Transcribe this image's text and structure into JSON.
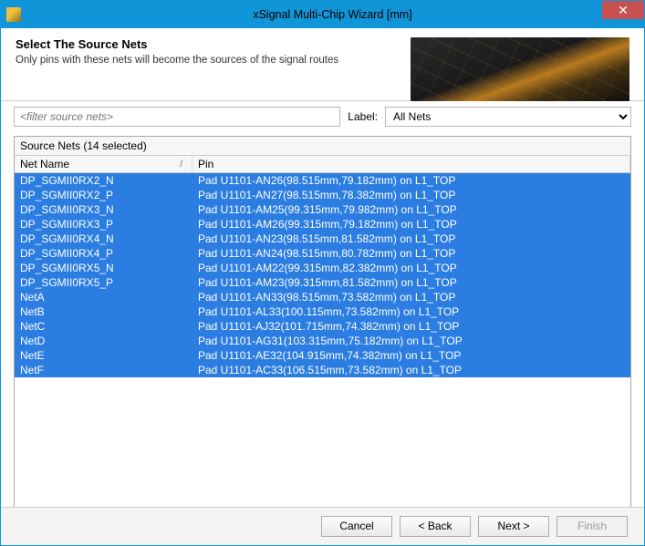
{
  "window": {
    "title": "xSignal Multi-Chip Wizard [mm]"
  },
  "header": {
    "heading": "Select The Source Nets",
    "sub": "Only pins with these nets will become the sources of the signal routes"
  },
  "filter": {
    "placeholder": "<filter source nets>"
  },
  "label": {
    "caption": "Label:",
    "selected": "All Nets",
    "options": [
      "All Nets"
    ]
  },
  "grid": {
    "caption": "Source Nets (14 selected)",
    "columns": {
      "net": "Net Name",
      "pin": "Pin"
    },
    "rows": [
      {
        "net": "DP_SGMII0RX2_N",
        "pin": "Pad U1101-AN26(98.515mm,79.182mm) on L1_TOP"
      },
      {
        "net": "DP_SGMII0RX2_P",
        "pin": "Pad U1101-AN27(98.515mm,78.382mm) on L1_TOP"
      },
      {
        "net": "DP_SGMII0RX3_N",
        "pin": "Pad U1101-AM25(99.315mm,79.982mm) on L1_TOP"
      },
      {
        "net": "DP_SGMII0RX3_P",
        "pin": "Pad U1101-AM26(99.315mm,79.182mm) on L1_TOP"
      },
      {
        "net": "DP_SGMII0RX4_N",
        "pin": "Pad U1101-AN23(98.515mm,81.582mm) on L1_TOP"
      },
      {
        "net": "DP_SGMII0RX4_P",
        "pin": "Pad U1101-AN24(98.515mm,80.782mm) on L1_TOP"
      },
      {
        "net": "DP_SGMII0RX5_N",
        "pin": "Pad U1101-AM22(99.315mm,82.382mm) on L1_TOP"
      },
      {
        "net": "DP_SGMII0RX5_P",
        "pin": "Pad U1101-AM23(99.315mm,81.582mm) on L1_TOP"
      },
      {
        "net": "NetA",
        "pin": "Pad U1101-AN33(98.515mm,73.582mm) on L1_TOP"
      },
      {
        "net": "NetB",
        "pin": "Pad U1101-AL33(100.115mm,73.582mm) on L1_TOP"
      },
      {
        "net": "NetC",
        "pin": "Pad U1101-AJ32(101.715mm,74.382mm) on L1_TOP"
      },
      {
        "net": "NetD",
        "pin": "Pad U1101-AG31(103.315mm,75.182mm) on L1_TOP"
      },
      {
        "net": "NetE",
        "pin": "Pad U1101-AE32(104.915mm,74.382mm) on L1_TOP"
      },
      {
        "net": "NetF",
        "pin": "Pad U1101-AC33(106.515mm,73.582mm) on L1_TOP"
      }
    ]
  },
  "buttons": {
    "cancel": "Cancel",
    "back": "< Back",
    "next": "Next >",
    "finish": "Finish"
  }
}
